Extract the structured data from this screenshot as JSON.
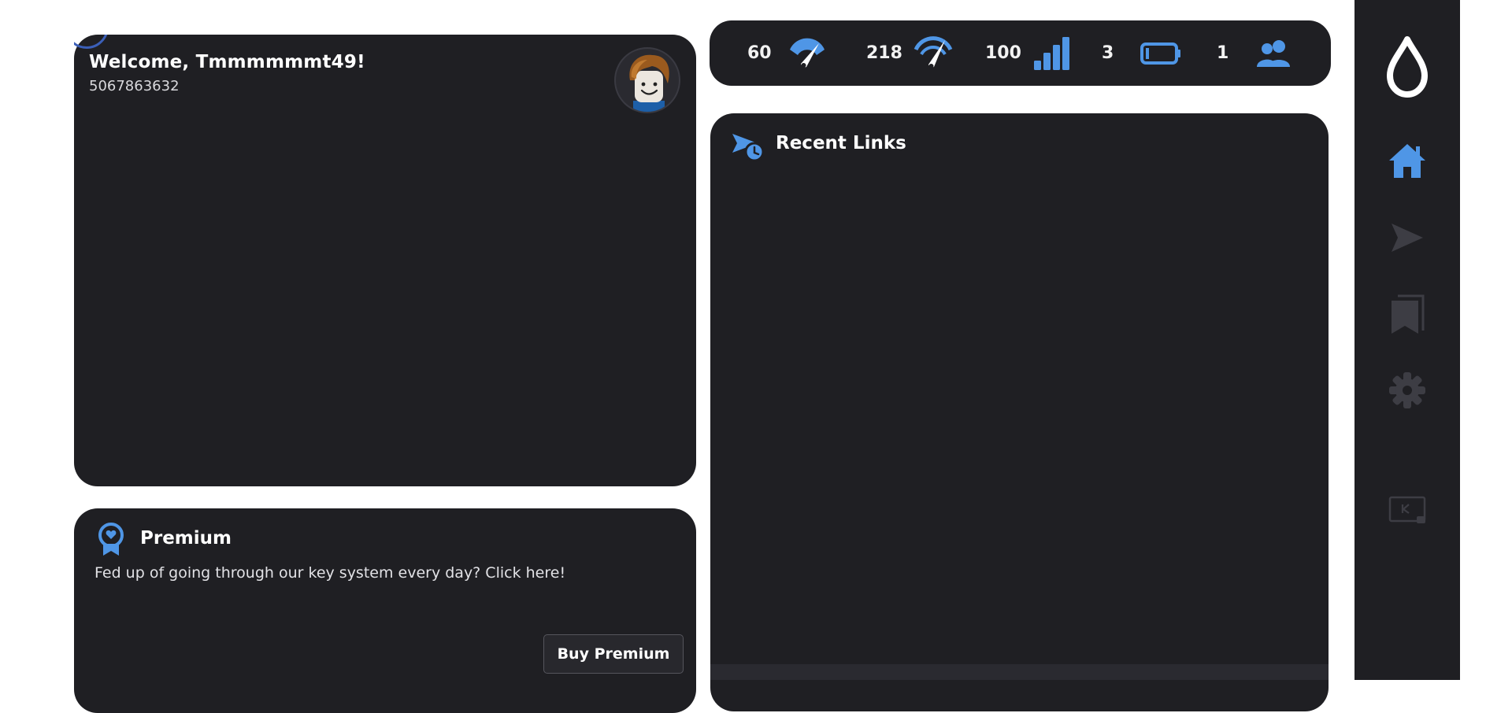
{
  "welcome": {
    "title": "Welcome, Tmmmmmmt49!",
    "user_id": "5067863632"
  },
  "premium": {
    "title": "Premium",
    "description": "Fed up of going through our key system every day? Click here!",
    "button_label": "Buy Premium",
    "icon": "award-ribbon-icon"
  },
  "stats": [
    {
      "value": "60",
      "icon": "speedometer-icon"
    },
    {
      "value": "218",
      "icon": "speedometer-icon"
    },
    {
      "value": "100",
      "icon": "signal-bars-icon"
    },
    {
      "value": "3",
      "icon": "battery-icon"
    },
    {
      "value": "1",
      "icon": "users-icon"
    }
  ],
  "recent": {
    "title": "Recent Links",
    "icon": "send-clock-icon"
  },
  "sidebar": {
    "items": [
      {
        "icon": "droplet-logo-icon",
        "active": false
      },
      {
        "icon": "home-icon",
        "active": true
      },
      {
        "icon": "send-icon",
        "active": false
      },
      {
        "icon": "bookmark-icon",
        "active": false
      },
      {
        "icon": "gear-icon",
        "active": false
      },
      {
        "icon": "key-screen-icon",
        "active": false
      }
    ]
  },
  "colors": {
    "card_bg": "#1f1f23",
    "accent": "#4f96e6",
    "inactive_icon": "#3d3d44"
  }
}
